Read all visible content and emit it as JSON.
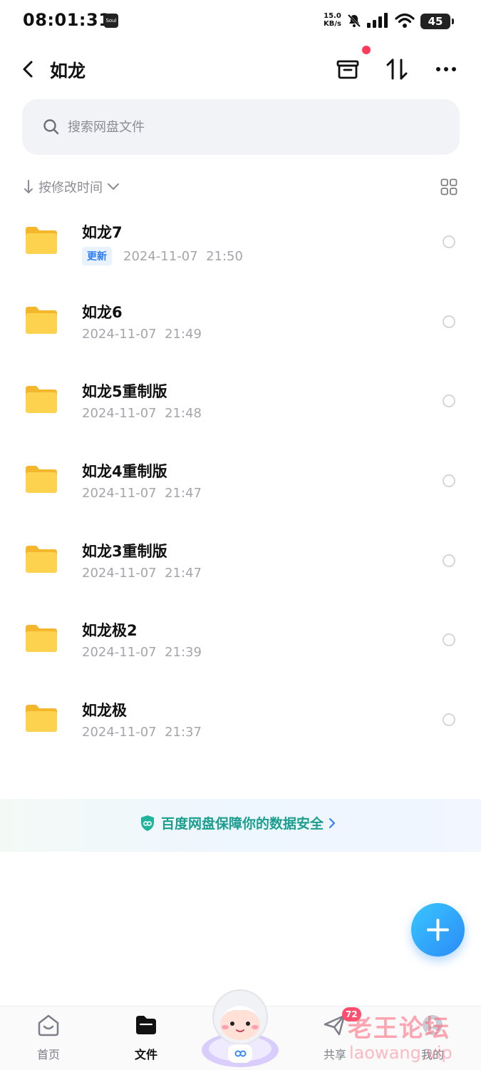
{
  "status_bar": {
    "time": "08:01:31",
    "app_badge": "Soul",
    "net_speed_value": "15.0",
    "net_speed_unit": "KB/s",
    "battery": "45"
  },
  "header": {
    "title": "如龙",
    "icons": [
      "back-icon",
      "recycle-box-icon",
      "transfer-icon",
      "more-icon"
    ],
    "notification_dot_color": "#ff3b5c"
  },
  "search": {
    "placeholder": "搜索网盘文件"
  },
  "sort": {
    "label": "按修改时间"
  },
  "files": [
    {
      "name": "如龙7",
      "tag": "更新",
      "date": "2024-11-07",
      "time": "21:50"
    },
    {
      "name": "如龙6",
      "tag": "",
      "date": "2024-11-07",
      "time": "21:49"
    },
    {
      "name": "如龙5重制版",
      "tag": "",
      "date": "2024-11-07",
      "time": "21:48"
    },
    {
      "name": "如龙4重制版",
      "tag": "",
      "date": "2024-11-07",
      "time": "21:47"
    },
    {
      "name": "如龙3重制版",
      "tag": "",
      "date": "2024-11-07",
      "time": "21:47"
    },
    {
      "name": "如龙极2",
      "tag": "",
      "date": "2024-11-07",
      "time": "21:39"
    },
    {
      "name": "如龙极",
      "tag": "",
      "date": "2024-11-07",
      "time": "21:37"
    }
  ],
  "banner": {
    "text": "百度网盘保障你的数据安全"
  },
  "bottom_nav": {
    "items": [
      {
        "label": "首页",
        "icon": "home-icon"
      },
      {
        "label": "文件",
        "icon": "folder-icon"
      },
      {
        "label": "共享",
        "icon": "send-icon"
      },
      {
        "label": "我的",
        "icon": "profile-icon"
      }
    ],
    "share_badge": "72"
  },
  "watermark": {
    "line1": "老王论坛",
    "line2": "laowang.vip"
  },
  "colors": {
    "accent": "#2b8bf7",
    "folder": "#fbc53a",
    "secure_text": "#1b9e8f",
    "badge": "#ff4d6d"
  }
}
